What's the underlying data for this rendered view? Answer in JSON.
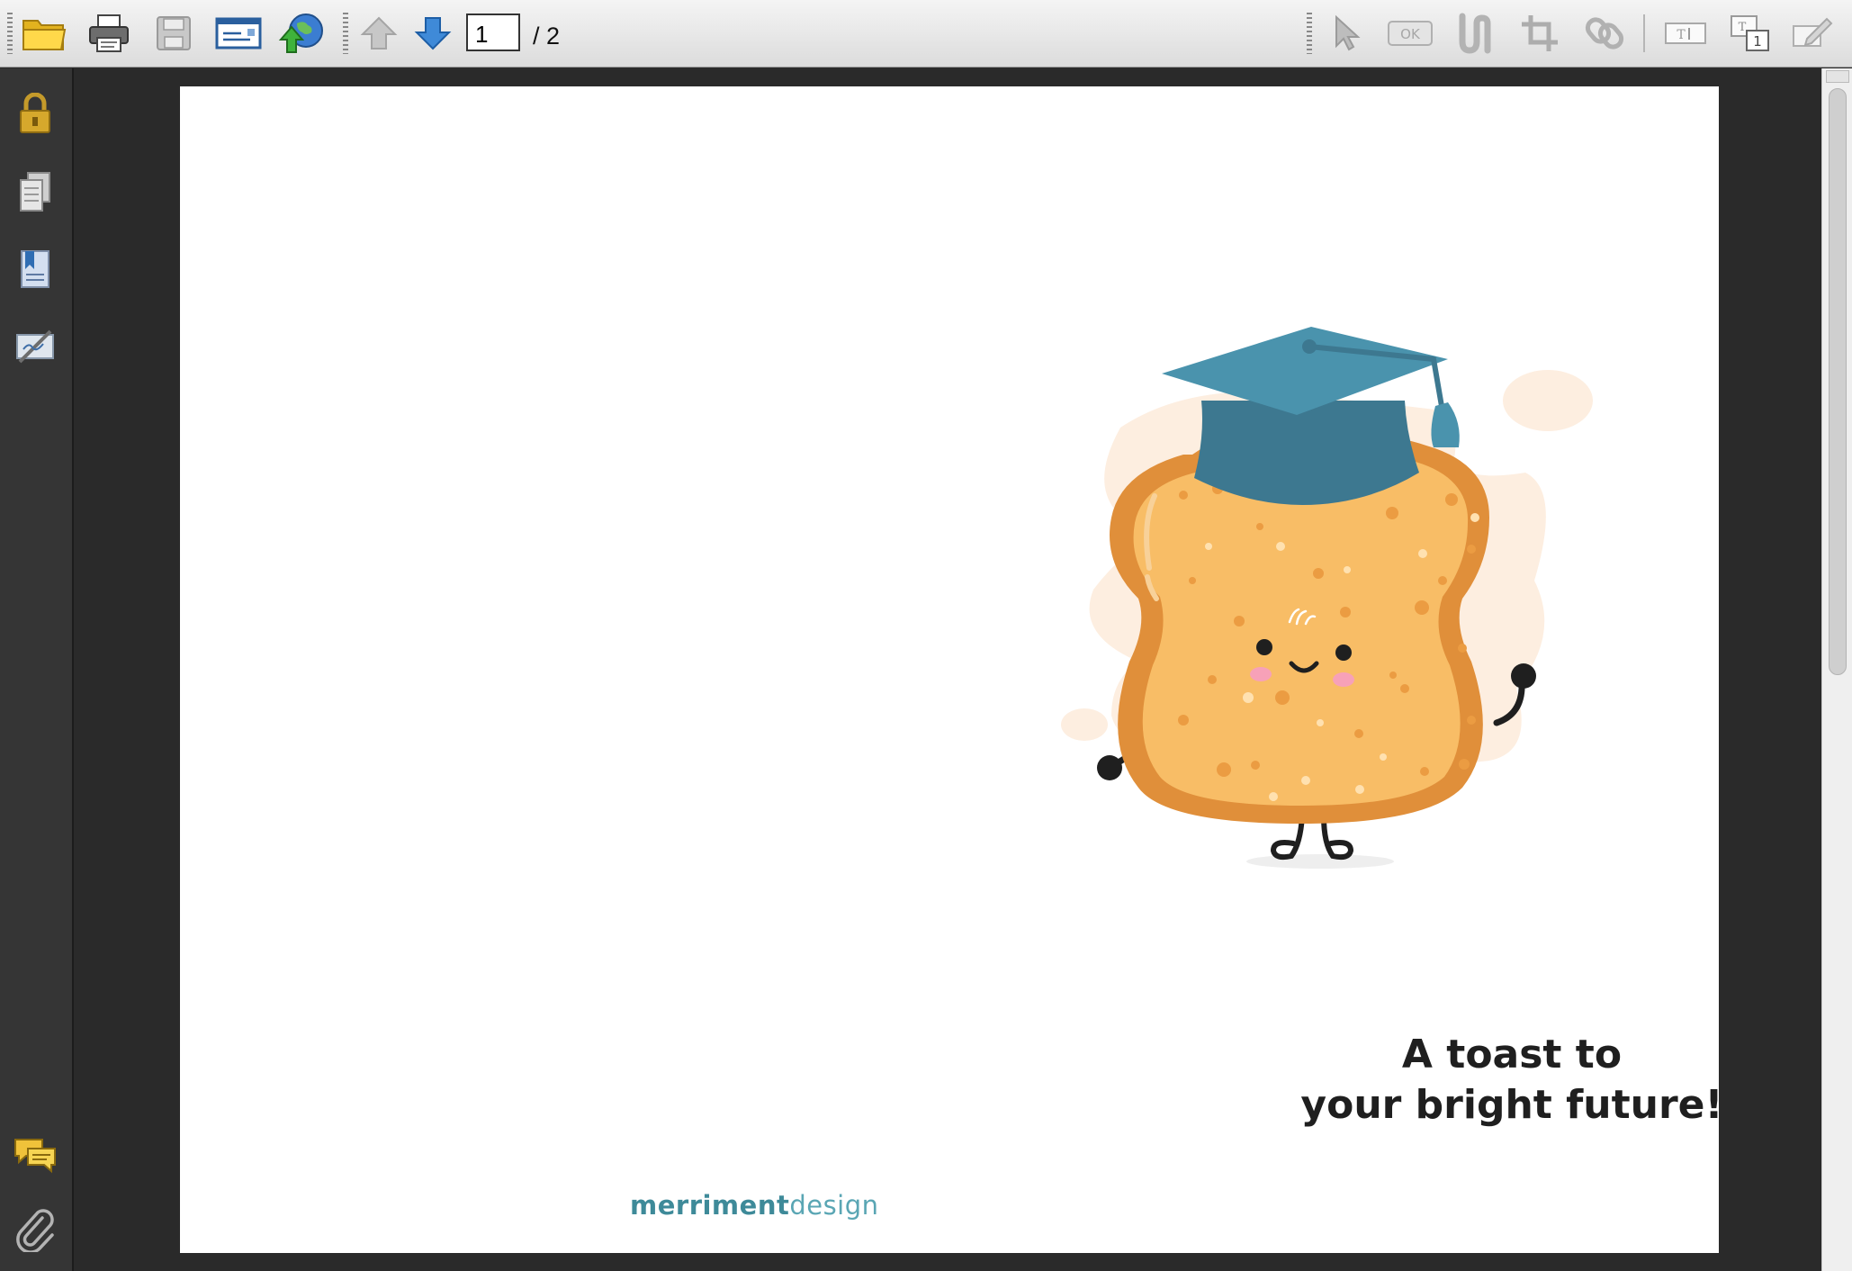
{
  "toolbar": {
    "buttons": [
      {
        "name": "open-folder-icon"
      },
      {
        "name": "print-icon"
      },
      {
        "name": "save-icon"
      },
      {
        "name": "email-icon"
      },
      {
        "name": "web-upload-icon"
      },
      {
        "name": "previous-page-icon"
      },
      {
        "name": "next-page-icon"
      }
    ],
    "page_current": "1",
    "page_total_label": "/  2",
    "right_tools": [
      "select-tool-icon",
      "ok-button-icon",
      "touchup-tool-icon",
      "crop-tool-icon",
      "link-tool-icon",
      "text-field-icon",
      "numbered-field-icon",
      "edit-form-icon"
    ],
    "ok_label": "OK"
  },
  "sidebar": {
    "items": [
      "lock-icon",
      "pages-icon",
      "bookmarks-icon",
      "signatures-icon"
    ],
    "bottom_items": [
      "comments-icon",
      "attachments-icon"
    ]
  },
  "document": {
    "headline_line1": "A toast to",
    "headline_line2": "your bright future!",
    "brand_bold": "merriment",
    "brand_light": "design"
  },
  "colors": {
    "cap": "#4a93ad",
    "cap_band": "#3d7890",
    "toast_crust": "#e08f3a",
    "toast_inner": "#f8bd66",
    "splash": "#fdeee0",
    "brand": "#3e8a99"
  }
}
